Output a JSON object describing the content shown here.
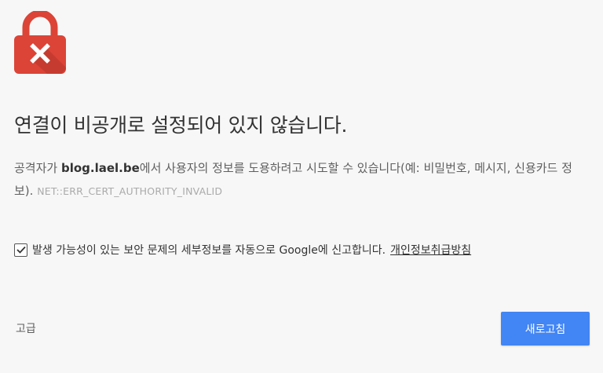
{
  "interstitial": {
    "heading": "연결이 비공개로 설정되어 있지 않습니다.",
    "explanation_prefix": "공격자가 ",
    "domain": "blog.lael.be",
    "explanation_suffix": "에서 사용자의 정보를 도용하려고 시도할 수 있습니다(예: 비밀번호, 메시지, 신용카드 정보).",
    "error_code": "NET::ERR_CERT_AUTHORITY_INVALID",
    "report_checkbox_checked": true,
    "report_text": "발생 가능성이 있는 보안 문제의 세부정보를 자동으로 Google에 신고합니다.",
    "privacy_link": "개인정보취급방침",
    "advanced_label": "고급",
    "reload_label": "새로고침",
    "lock_icon": "red-lock-error-icon"
  },
  "colors": {
    "lock_red": "#db4437",
    "lock_shadow": "#b5342a",
    "button_blue": "#4285f4",
    "background": "#f7f7f7"
  }
}
